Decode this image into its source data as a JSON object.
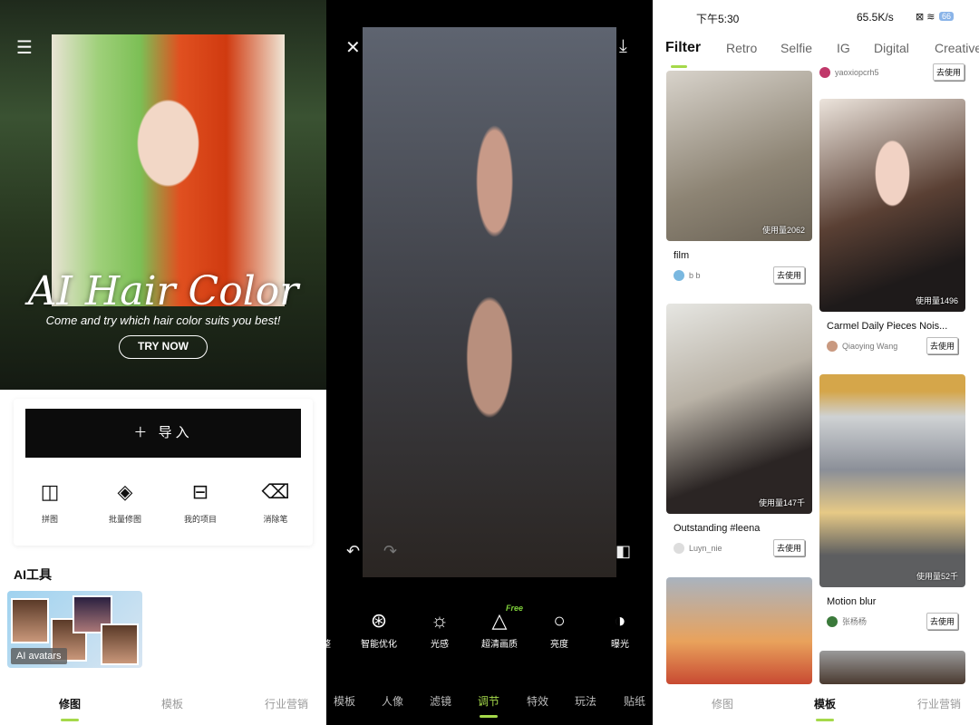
{
  "left": {
    "banner": {
      "title": "AI Hair Color",
      "subtitle": "Come and try which hair color suits you best!",
      "cta": "TRY NOW"
    },
    "import_label": "＋  导入",
    "tools": [
      {
        "label": "拼图",
        "icon": "collage-icon",
        "glyph": "◫"
      },
      {
        "label": "批量修图",
        "icon": "paint-bucket-icon",
        "glyph": "◈"
      },
      {
        "label": "我的项目",
        "icon": "inbox-icon",
        "glyph": "⊟"
      },
      {
        "label": "消除笔",
        "icon": "eraser-icon",
        "glyph": "⌫"
      }
    ],
    "section_title": "AI工具",
    "ai_card_label": "AI avatars",
    "nav": [
      {
        "label": "修图",
        "active": true
      },
      {
        "label": "模板",
        "active": false
      },
      {
        "label": "行业营销",
        "active": false
      }
    ]
  },
  "middle": {
    "adjustments": [
      {
        "label": "调整",
        "glyph": "◐"
      },
      {
        "label": "智能优化",
        "glyph": "⊛"
      },
      {
        "label": "光感",
        "glyph": "☼"
      },
      {
        "label": "超清画质",
        "glyph": "△"
      },
      {
        "label": "亮度",
        "glyph": "○"
      },
      {
        "label": "曝光",
        "glyph": "◑"
      }
    ],
    "free_badge": "Free",
    "tabs": [
      {
        "label": "模板"
      },
      {
        "label": "人像"
      },
      {
        "label": "滤镜"
      },
      {
        "label": "调节",
        "active": true
      },
      {
        "label": "特效"
      },
      {
        "label": "玩法"
      },
      {
        "label": "贴纸"
      }
    ],
    "accent": "#a5d94a"
  },
  "right": {
    "status": {
      "time": "下午5:30",
      "network": "65.5K/s",
      "battery": "66"
    },
    "tabs": [
      {
        "label": "Filter",
        "active": true
      },
      {
        "label": "Retro"
      },
      {
        "label": "Selfie"
      },
      {
        "label": "IG"
      },
      {
        "label": "Digital"
      },
      {
        "label": "Creative"
      }
    ],
    "use_label": "去使用",
    "col1": [
      {
        "title": "film",
        "user": "b b",
        "uses": "使用量2062"
      },
      {
        "title": "Outstanding #leena",
        "user": "Luyn_nie",
        "uses": "使用量147千"
      }
    ],
    "col2_top_user": "yaoxiopcrh5",
    "col2": [
      {
        "title": "Carmel Daily Pieces Nois...",
        "user": "Qiaoying Wang",
        "uses": "使用量1496"
      },
      {
        "title": "Motion blur",
        "user": "张杨杨",
        "uses": "使用量52千"
      }
    ],
    "nav": [
      {
        "label": "修图"
      },
      {
        "label": "模板",
        "active": true
      },
      {
        "label": "行业营销"
      }
    ]
  }
}
